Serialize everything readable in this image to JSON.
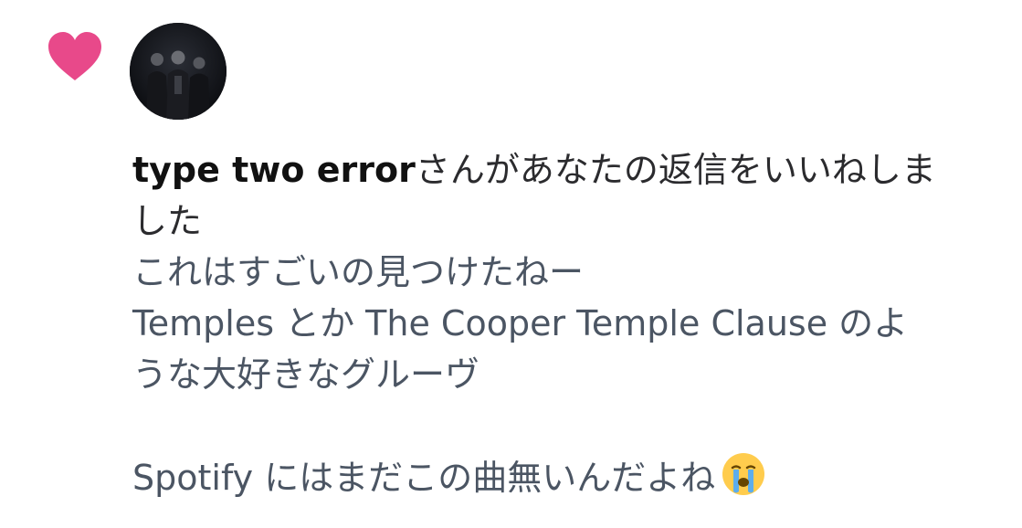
{
  "notification": {
    "icon": "heart-icon",
    "icon_color": "#e8498a",
    "avatar": "band-photo-avatar",
    "actor_name": "type two error",
    "action_line1": "さんがあなたの返信をいいねしま",
    "action_line2": "した",
    "reply": {
      "line1": "これはすごいの見つけたねー",
      "line2": "Temples とか The Cooper Temple Clause のよ",
      "line3": "うな大好きなグルーヴ",
      "line4": "Spotify にはまだこの曲無いんだよね",
      "emoji": "loudly-crying-face-emoji"
    },
    "colors": {
      "actor_text": "#111111",
      "body_text": "#2b2b2e",
      "reply_text": "#4b5563"
    }
  }
}
